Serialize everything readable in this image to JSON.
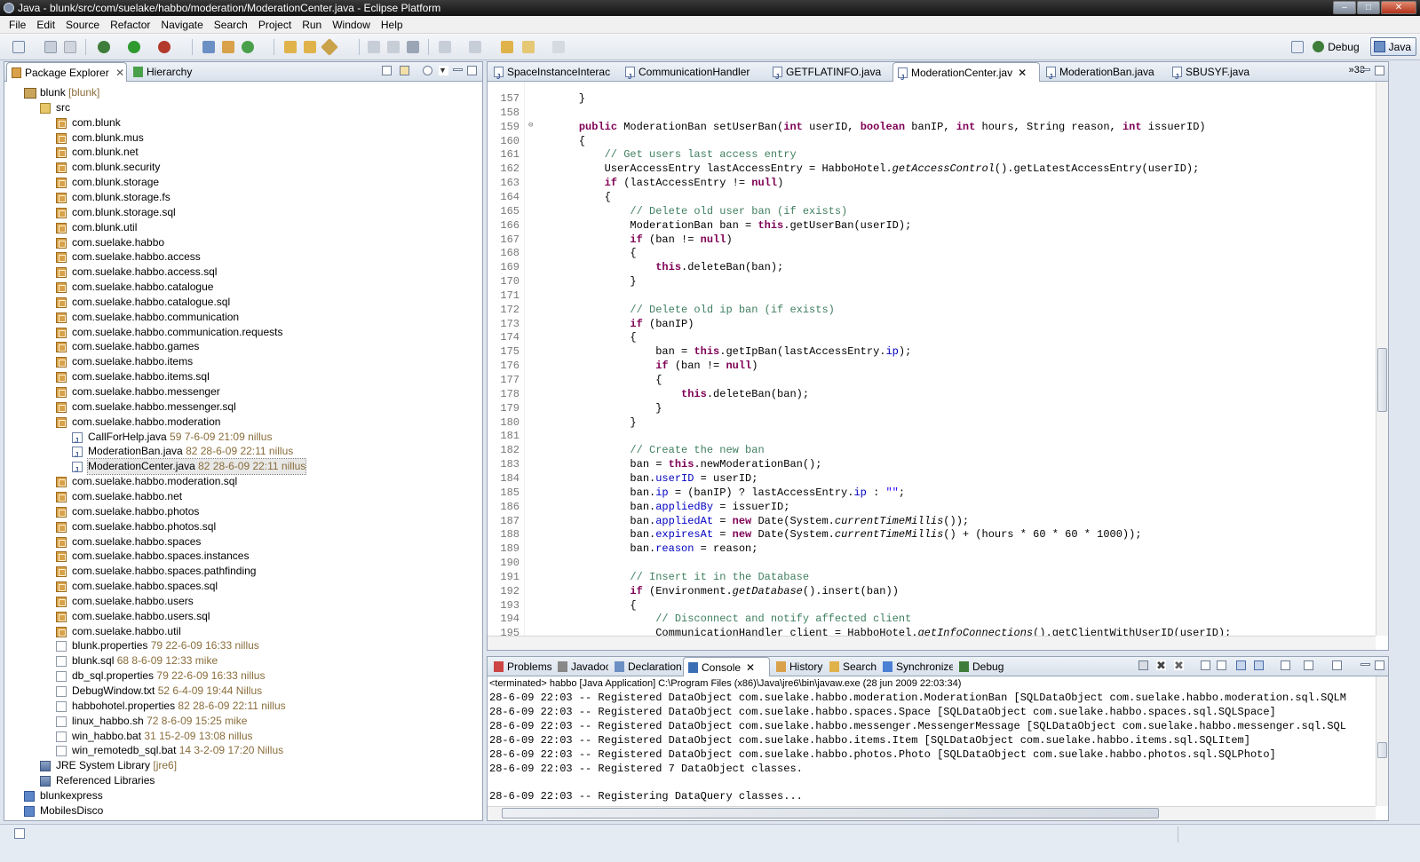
{
  "window": {
    "title": "Java - blunk/src/com/suelake/habbo/moderation/ModerationCenter.java - Eclipse Platform"
  },
  "menu": [
    "File",
    "Edit",
    "Source",
    "Refactor",
    "Navigate",
    "Search",
    "Project",
    "Run",
    "Window",
    "Help"
  ],
  "perspectives": {
    "debug": "Debug",
    "java": "Java"
  },
  "explorer": {
    "tabs": [
      "Package Explorer",
      "Hierarchy"
    ],
    "tree": [
      {
        "label": "blunk",
        "decoration": " [blunk]",
        "icon": "project-icon",
        "depth": 0
      },
      {
        "label": "src",
        "decoration": "",
        "icon": "source-folder-icon",
        "depth": 1
      },
      {
        "label": "com.blunk",
        "decoration": "",
        "icon": "package-icon",
        "depth": 2
      },
      {
        "label": "com.blunk.mus",
        "decoration": "",
        "icon": "package-icon",
        "depth": 2
      },
      {
        "label": "com.blunk.net",
        "decoration": "",
        "icon": "package-icon",
        "depth": 2
      },
      {
        "label": "com.blunk.security",
        "decoration": "",
        "icon": "package-icon",
        "depth": 2
      },
      {
        "label": "com.blunk.storage",
        "decoration": "",
        "icon": "package-icon",
        "depth": 2
      },
      {
        "label": "com.blunk.storage.fs",
        "decoration": "",
        "icon": "package-icon",
        "depth": 2
      },
      {
        "label": "com.blunk.storage.sql",
        "decoration": "",
        "icon": "package-icon",
        "depth": 2
      },
      {
        "label": "com.blunk.util",
        "decoration": "",
        "icon": "package-icon",
        "depth": 2
      },
      {
        "label": "com.suelake.habbo",
        "decoration": "",
        "icon": "package-icon",
        "depth": 2
      },
      {
        "label": "com.suelake.habbo.access",
        "decoration": "",
        "icon": "package-icon",
        "depth": 2
      },
      {
        "label": "com.suelake.habbo.access.sql",
        "decoration": "",
        "icon": "package-icon",
        "depth": 2
      },
      {
        "label": "com.suelake.habbo.catalogue",
        "decoration": "",
        "icon": "package-icon",
        "depth": 2
      },
      {
        "label": "com.suelake.habbo.catalogue.sql",
        "decoration": "",
        "icon": "package-icon",
        "depth": 2
      },
      {
        "label": "com.suelake.habbo.communication",
        "decoration": "",
        "icon": "package-icon",
        "depth": 2
      },
      {
        "label": "com.suelake.habbo.communication.requests",
        "decoration": "",
        "icon": "package-icon",
        "depth": 2
      },
      {
        "label": "com.suelake.habbo.games",
        "decoration": "",
        "icon": "package-icon",
        "depth": 2
      },
      {
        "label": "com.suelake.habbo.items",
        "decoration": "",
        "icon": "package-icon",
        "depth": 2
      },
      {
        "label": "com.suelake.habbo.items.sql",
        "decoration": "",
        "icon": "package-icon",
        "depth": 2
      },
      {
        "label": "com.suelake.habbo.messenger",
        "decoration": "",
        "icon": "package-icon",
        "depth": 2
      },
      {
        "label": "com.suelake.habbo.messenger.sql",
        "decoration": "",
        "icon": "package-icon",
        "depth": 2
      },
      {
        "label": "com.suelake.habbo.moderation",
        "decoration": "",
        "icon": "package-icon",
        "depth": 2
      },
      {
        "label": "CallForHelp.java",
        "decoration": " 59  7-6-09 21:09  nillus",
        "icon": "java-file-icon",
        "depth": 3
      },
      {
        "label": "ModerationBan.java",
        "decoration": " 82  28-6-09 22:11  nillus",
        "icon": "java-file-icon",
        "depth": 3
      },
      {
        "label": "ModerationCenter.java",
        "decoration": " 82  28-6-09 22:11  nillus",
        "icon": "java-file-icon",
        "depth": 3,
        "selected": true
      },
      {
        "label": "com.suelake.habbo.moderation.sql",
        "decoration": "",
        "icon": "package-icon",
        "depth": 2
      },
      {
        "label": "com.suelake.habbo.net",
        "decoration": "",
        "icon": "package-icon",
        "depth": 2
      },
      {
        "label": "com.suelake.habbo.photos",
        "decoration": "",
        "icon": "package-icon",
        "depth": 2
      },
      {
        "label": "com.suelake.habbo.photos.sql",
        "decoration": "",
        "icon": "package-icon",
        "depth": 2
      },
      {
        "label": "com.suelake.habbo.spaces",
        "decoration": "",
        "icon": "package-icon",
        "depth": 2
      },
      {
        "label": "com.suelake.habbo.spaces.instances",
        "decoration": "",
        "icon": "package-icon",
        "depth": 2
      },
      {
        "label": "com.suelake.habbo.spaces.pathfinding",
        "decoration": "",
        "icon": "package-icon",
        "depth": 2
      },
      {
        "label": "com.suelake.habbo.spaces.sql",
        "decoration": "",
        "icon": "package-icon",
        "depth": 2
      },
      {
        "label": "com.suelake.habbo.users",
        "decoration": "",
        "icon": "package-icon",
        "depth": 2
      },
      {
        "label": "com.suelake.habbo.users.sql",
        "decoration": "",
        "icon": "package-icon",
        "depth": 2
      },
      {
        "label": "com.suelake.habbo.util",
        "decoration": "",
        "icon": "package-icon",
        "depth": 2
      },
      {
        "label": "blunk.properties",
        "decoration": " 79  22-6-09 16:33  nillus",
        "icon": "text-file-icon",
        "depth": 2
      },
      {
        "label": "blunk.sql",
        "decoration": " 68  8-6-09 12:33  mike",
        "icon": "text-file-icon",
        "depth": 2
      },
      {
        "label": "db_sql.properties",
        "decoration": " 79  22-6-09 16:33  nillus",
        "icon": "text-file-icon",
        "depth": 2
      },
      {
        "label": "DebugWindow.txt",
        "decoration": " 52  6-4-09 19:44  Nillus",
        "icon": "text-file-icon",
        "depth": 2
      },
      {
        "label": "habbohotel.properties",
        "decoration": " 82  28-6-09 22:11  nillus",
        "icon": "text-file-icon",
        "depth": 2
      },
      {
        "label": "linux_habbo.sh",
        "decoration": " 72  8-6-09 15:25  mike",
        "icon": "text-file-icon",
        "depth": 2
      },
      {
        "label": "win_habbo.bat",
        "decoration": " 31  15-2-09 13:08  nillus",
        "icon": "batch-file-icon",
        "depth": 2
      },
      {
        "label": "win_remotedb_sql.bat",
        "decoration": " 14  3-2-09 17:20  Nillus",
        "icon": "batch-file-icon",
        "depth": 2
      },
      {
        "label": "JRE System Library",
        "decoration": " [jre6]",
        "icon": "library-icon",
        "depth": 1
      },
      {
        "label": "Referenced Libraries",
        "decoration": "",
        "icon": "library-icon",
        "depth": 1
      },
      {
        "label": "blunkexpress",
        "decoration": "",
        "icon": "closed-project-icon",
        "depth": 0
      },
      {
        "label": "MobilesDisco",
        "decoration": "",
        "icon": "closed-project-icon",
        "depth": 0
      }
    ]
  },
  "editor": {
    "tabs": [
      "SpaceInstanceInterac",
      "CommunicationHandler",
      "GETFLATINFO.java",
      "ModerationCenter.jav",
      "ModerationBan.java",
      "SBUSYF.java"
    ],
    "active_tab_index": 3,
    "overflow_count": "33",
    "lines": [
      {
        "n": "157",
        "segs": [
          {
            "t": "    }"
          }
        ]
      },
      {
        "n": "158",
        "segs": [
          {
            "t": ""
          }
        ]
      },
      {
        "n": "159",
        "segs": [
          {
            "t": "    "
          },
          {
            "t": "public",
            "c": "kw"
          },
          {
            "t": " ModerationBan setUserBan("
          },
          {
            "t": "int",
            "c": "kw"
          },
          {
            "t": " userID, "
          },
          {
            "t": "boolean",
            "c": "kw"
          },
          {
            "t": " banIP, "
          },
          {
            "t": "int",
            "c": "kw"
          },
          {
            "t": " hours, String reason, "
          },
          {
            "t": "int",
            "c": "kw"
          },
          {
            "t": " issuerID)"
          }
        ]
      },
      {
        "n": "160",
        "segs": [
          {
            "t": "    {"
          }
        ]
      },
      {
        "n": "161",
        "segs": [
          {
            "t": "        "
          },
          {
            "t": "// Get users last access entry",
            "c": "cm"
          }
        ]
      },
      {
        "n": "162",
        "segs": [
          {
            "t": "        UserAccessEntry lastAccessEntry = HabboHotel."
          },
          {
            "t": "getAccessControl",
            "c": "it"
          },
          {
            "t": "().getLatestAccessEntry(userID);"
          }
        ]
      },
      {
        "n": "163",
        "segs": [
          {
            "t": "        "
          },
          {
            "t": "if",
            "c": "kw"
          },
          {
            "t": " (lastAccessEntry != "
          },
          {
            "t": "null",
            "c": "kw"
          },
          {
            "t": ")"
          }
        ]
      },
      {
        "n": "164",
        "segs": [
          {
            "t": "        {"
          }
        ]
      },
      {
        "n": "165",
        "segs": [
          {
            "t": "            "
          },
          {
            "t": "// Delete old user ban (if exists)",
            "c": "cm"
          }
        ]
      },
      {
        "n": "166",
        "segs": [
          {
            "t": "            ModerationBan ban = "
          },
          {
            "t": "this",
            "c": "kw"
          },
          {
            "t": ".getUserBan(userID);"
          }
        ]
      },
      {
        "n": "167",
        "segs": [
          {
            "t": "            "
          },
          {
            "t": "if",
            "c": "kw"
          },
          {
            "t": " (ban != "
          },
          {
            "t": "null",
            "c": "kw"
          },
          {
            "t": ")"
          }
        ]
      },
      {
        "n": "168",
        "segs": [
          {
            "t": "            {"
          }
        ]
      },
      {
        "n": "169",
        "segs": [
          {
            "t": "                "
          },
          {
            "t": "this",
            "c": "kw"
          },
          {
            "t": ".deleteBan(ban);"
          }
        ]
      },
      {
        "n": "170",
        "segs": [
          {
            "t": "            }"
          }
        ]
      },
      {
        "n": "171",
        "segs": [
          {
            "t": ""
          }
        ]
      },
      {
        "n": "172",
        "segs": [
          {
            "t": "            "
          },
          {
            "t": "// Delete old ip ban (if exists)",
            "c": "cm"
          }
        ]
      },
      {
        "n": "173",
        "segs": [
          {
            "t": "            "
          },
          {
            "t": "if",
            "c": "kw"
          },
          {
            "t": " (banIP)"
          }
        ]
      },
      {
        "n": "174",
        "segs": [
          {
            "t": "            {"
          }
        ]
      },
      {
        "n": "175",
        "segs": [
          {
            "t": "                ban = "
          },
          {
            "t": "this",
            "c": "kw"
          },
          {
            "t": ".getIpBan(lastAccessEntry."
          },
          {
            "t": "ip",
            "c": "fd"
          },
          {
            "t": ");"
          }
        ]
      },
      {
        "n": "176",
        "segs": [
          {
            "t": "                "
          },
          {
            "t": "if",
            "c": "kw"
          },
          {
            "t": " (ban != "
          },
          {
            "t": "null",
            "c": "kw"
          },
          {
            "t": ")"
          }
        ]
      },
      {
        "n": "177",
        "segs": [
          {
            "t": "                {"
          }
        ]
      },
      {
        "n": "178",
        "segs": [
          {
            "t": "                    "
          },
          {
            "t": "this",
            "c": "kw"
          },
          {
            "t": ".deleteBan(ban);"
          }
        ]
      },
      {
        "n": "179",
        "segs": [
          {
            "t": "                }"
          }
        ]
      },
      {
        "n": "180",
        "segs": [
          {
            "t": "            }"
          }
        ]
      },
      {
        "n": "181",
        "segs": [
          {
            "t": ""
          }
        ]
      },
      {
        "n": "182",
        "segs": [
          {
            "t": "            "
          },
          {
            "t": "// Create the new ban",
            "c": "cm"
          }
        ]
      },
      {
        "n": "183",
        "segs": [
          {
            "t": "            ban = "
          },
          {
            "t": "this",
            "c": "kw"
          },
          {
            "t": ".newModerationBan();"
          }
        ]
      },
      {
        "n": "184",
        "segs": [
          {
            "t": "            ban."
          },
          {
            "t": "userID",
            "c": "fd"
          },
          {
            "t": " = userID;"
          }
        ]
      },
      {
        "n": "185",
        "segs": [
          {
            "t": "            ban."
          },
          {
            "t": "ip",
            "c": "fd"
          },
          {
            "t": " = (banIP) ? lastAccessEntry."
          },
          {
            "t": "ip",
            "c": "fd"
          },
          {
            "t": " : "
          },
          {
            "t": "\"\"",
            "c": "st"
          },
          {
            "t": ";"
          }
        ]
      },
      {
        "n": "186",
        "segs": [
          {
            "t": "            ban."
          },
          {
            "t": "appliedBy",
            "c": "fd"
          },
          {
            "t": " = issuerID;"
          }
        ]
      },
      {
        "n": "187",
        "segs": [
          {
            "t": "            ban."
          },
          {
            "t": "appliedAt",
            "c": "fd"
          },
          {
            "t": " = "
          },
          {
            "t": "new",
            "c": "kw"
          },
          {
            "t": " Date(System."
          },
          {
            "t": "currentTimeMillis",
            "c": "it"
          },
          {
            "t": "());"
          }
        ]
      },
      {
        "n": "188",
        "segs": [
          {
            "t": "            ban."
          },
          {
            "t": "expiresAt",
            "c": "fd"
          },
          {
            "t": " = "
          },
          {
            "t": "new",
            "c": "kw"
          },
          {
            "t": " Date(System."
          },
          {
            "t": "currentTimeMillis",
            "c": "it"
          },
          {
            "t": "() + (hours * 60 * 60 * 1000));"
          }
        ]
      },
      {
        "n": "189",
        "segs": [
          {
            "t": "            ban."
          },
          {
            "t": "reason",
            "c": "fd"
          },
          {
            "t": " = reason;"
          }
        ]
      },
      {
        "n": "190",
        "segs": [
          {
            "t": ""
          }
        ]
      },
      {
        "n": "191",
        "segs": [
          {
            "t": "            "
          },
          {
            "t": "// Insert it in the Database",
            "c": "cm"
          }
        ]
      },
      {
        "n": "192",
        "segs": [
          {
            "t": "            "
          },
          {
            "t": "if",
            "c": "kw"
          },
          {
            "t": " (Environment."
          },
          {
            "t": "getDatabase",
            "c": "it"
          },
          {
            "t": "().insert(ban))"
          }
        ]
      },
      {
        "n": "193",
        "segs": [
          {
            "t": "            {"
          }
        ]
      },
      {
        "n": "194",
        "segs": [
          {
            "t": "                "
          },
          {
            "t": "// Disconnect and notify affected client",
            "c": "cm"
          }
        ]
      },
      {
        "n": "195",
        "segs": [
          {
            "t": "                CommunicationHandler client = HabboHotel."
          },
          {
            "t": "getInfoConnections",
            "c": "it"
          },
          {
            "t": "().getClientWithUserID(userID);"
          }
        ]
      }
    ]
  },
  "bottom": {
    "tabs": [
      "Problems",
      "Javadoc",
      "Declaration",
      "Console",
      "History",
      "Search",
      "Synchronize",
      "Debug"
    ],
    "active_tab_index": 3,
    "console_status": "<terminated> habbo [Java Application] C:\\Program Files (x86)\\Java\\jre6\\bin\\javaw.exe (28 jun 2009 22:03:34)",
    "console_lines": [
      "28-6-09 22:03 -- Registered DataObject com.suelake.habbo.moderation.ModerationBan [SQLDataObject com.suelake.habbo.moderation.sql.SQLM",
      "28-6-09 22:03 -- Registered DataObject com.suelake.habbo.spaces.Space [SQLDataObject com.suelake.habbo.spaces.sql.SQLSpace]",
      "28-6-09 22:03 -- Registered DataObject com.suelake.habbo.messenger.MessengerMessage [SQLDataObject com.suelake.habbo.messenger.sql.SQL",
      "28-6-09 22:03 -- Registered DataObject com.suelake.habbo.items.Item [SQLDataObject com.suelake.habbo.items.sql.SQLItem]",
      "28-6-09 22:03 -- Registered DataObject com.suelake.habbo.photos.Photo [SQLDataObject com.suelake.habbo.photos.sql.SQLPhoto]",
      "28-6-09 22:03 -- Registered 7 DataObject classes.",
      "",
      "28-6-09 22:03 -- Registering DataQuery classes..."
    ]
  }
}
